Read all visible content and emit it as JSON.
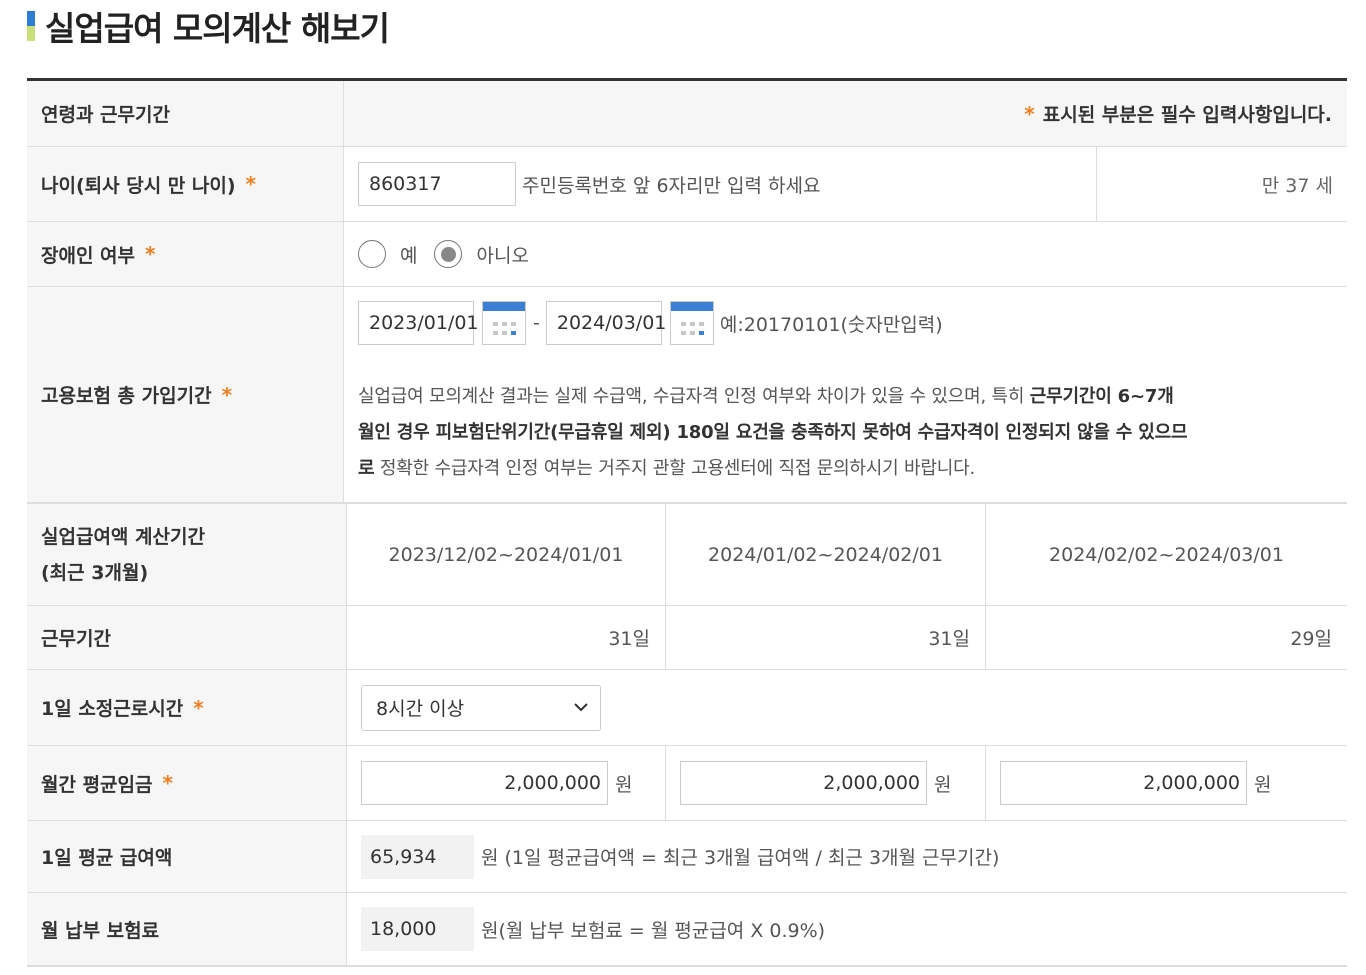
{
  "page_title": "실업급여 모의계산 해보기",
  "header": {
    "label": "연령과 근무기간",
    "required_star": "*",
    "required_note": "표시된 부분은 필수 입력사항입니다."
  },
  "age": {
    "label": "나이(퇴사 당시 만 나이)",
    "star": "*",
    "value": "860317",
    "hint": "주민등록번호 앞 6자리만 입력 하세요",
    "result": "만 37 세"
  },
  "disability": {
    "label": "장애인 여부",
    "star": "*",
    "options": [
      {
        "label": "예",
        "selected": false
      },
      {
        "label": "아니오",
        "selected": true
      }
    ]
  },
  "insurance": {
    "label": "고용보험 총 가입기간",
    "star": "*",
    "start": "2023/01/01",
    "separator": "-",
    "end": "2024/03/01",
    "example": "예:20170101(숫자만입력)",
    "notice_line1_a": "실업급여 모의계산 결과는 실제 수급액, 수급자격 인정 여부와 차이가 있을 수 있으며, 특히 ",
    "notice_line1_b": "근무기간이 6~7개",
    "notice_line2": "월인 경우 피보험단위기간(무급휴일 제외) 180일 요건을 충족하지 못하여 수급자격이 인정되지 않을 수 있으므",
    "notice_line3_a": "로",
    "notice_line3_b": " 정확한 수급자격 인정 여부는 거주지 관할 고용센터에 직접 문의하시기 바랍니다."
  },
  "calc_period": {
    "label_line1": "실업급여액 계산기간",
    "label_line2": "(최근 3개월)",
    "periods": [
      "2023/12/02~2024/01/01",
      "2024/01/02~2024/02/01",
      "2024/02/02~2024/03/01"
    ]
  },
  "work_days": {
    "label": "근무기간",
    "values": [
      "31일",
      "31일",
      "29일"
    ]
  },
  "daily_hours": {
    "label": "1일 소정근로시간",
    "star": "*",
    "selected": "8시간 이상"
  },
  "monthly_wage": {
    "label": "월간 평균임금",
    "star": "*",
    "values": [
      "2,000,000",
      "2,000,000",
      "2,000,000"
    ],
    "unit": "원"
  },
  "daily_benefit": {
    "label": "1일 평균 급여액",
    "value": "65,934",
    "formula": "원 (1일 평균급여액 = 최근 3개월 급여액 / 최근 3개월 근무기간)"
  },
  "monthly_premium": {
    "label": "월 납부 보험료",
    "value": "18,000",
    "formula": "원(월 납부 보험료 = 월 평균급여 X 0.9%)"
  },
  "colors": {
    "accent": "#f07d1f",
    "calendar": "#3b7fd3",
    "label_bg": "#f6f6f6",
    "border": "#dddddd"
  }
}
